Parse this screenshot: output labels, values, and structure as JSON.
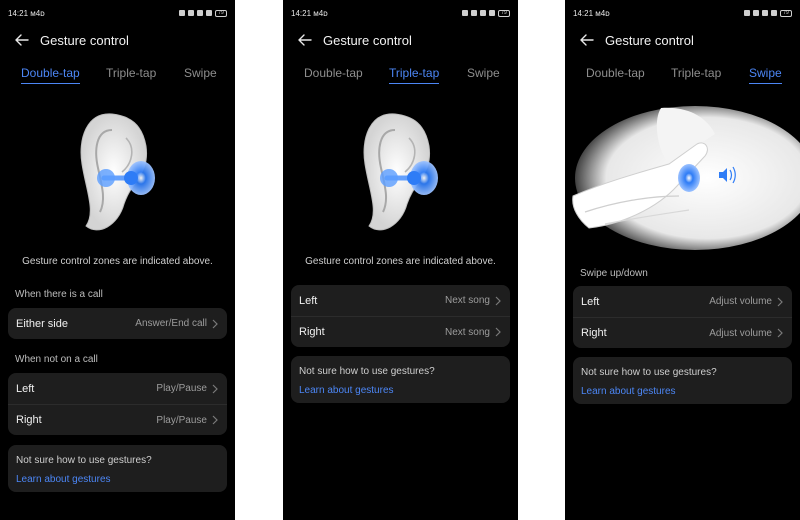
{
  "colors": {
    "accent": "#4c86f5",
    "card": "#1e1e1e",
    "background": "#000000"
  },
  "screens": [
    {
      "status": {
        "time": "14:21",
        "indicator": "ᴍ4ᴅ",
        "battery": "79"
      },
      "header": {
        "title": "Gesture control",
        "back_icon": "arrow-left-icon"
      },
      "tabs": [
        {
          "label": "Double-tap"
        },
        {
          "label": "Triple-tap"
        },
        {
          "label": "Swipe"
        }
      ],
      "active_tab": "Double-tap",
      "hint": "Gesture control zones are indicated above.",
      "section_call": "When there is a call",
      "call_row": {
        "label": "Either side",
        "value": "Answer/End call"
      },
      "section_no_call": "When not on a call",
      "rows": [
        {
          "label": "Left",
          "value": "Play/Pause"
        },
        {
          "label": "Right",
          "value": "Play/Pause"
        }
      ],
      "info": {
        "title": "Not sure how to use gestures?",
        "link": "Learn about gestures"
      }
    },
    {
      "status": {
        "time": "14:21",
        "indicator": "ᴍ4ᴅ",
        "battery": "79"
      },
      "header": {
        "title": "Gesture control",
        "back_icon": "arrow-left-icon"
      },
      "tabs": [
        {
          "label": "Double-tap"
        },
        {
          "label": "Triple-tap"
        },
        {
          "label": "Swipe"
        }
      ],
      "active_tab": "Triple-tap",
      "hint": "Gesture control zones are indicated above.",
      "rows": [
        {
          "label": "Left",
          "value": "Next song"
        },
        {
          "label": "Right",
          "value": "Next song"
        }
      ],
      "info": {
        "title": "Not sure how to use gestures?",
        "link": "Learn about gestures"
      }
    },
    {
      "status": {
        "time": "14:21",
        "indicator": "ᴍ4ᴅ",
        "battery": "79"
      },
      "header": {
        "title": "Gesture control",
        "back_icon": "arrow-left-icon"
      },
      "tabs": [
        {
          "label": "Double-tap"
        },
        {
          "label": "Triple-tap"
        },
        {
          "label": "Swipe"
        }
      ],
      "active_tab": "Swipe",
      "section_swipe": "Swipe up/down",
      "rows": [
        {
          "label": "Left",
          "value": "Adjust volume"
        },
        {
          "label": "Right",
          "value": "Adjust volume"
        }
      ],
      "info": {
        "title": "Not sure how to use gestures?",
        "link": "Learn about gestures"
      }
    }
  ]
}
